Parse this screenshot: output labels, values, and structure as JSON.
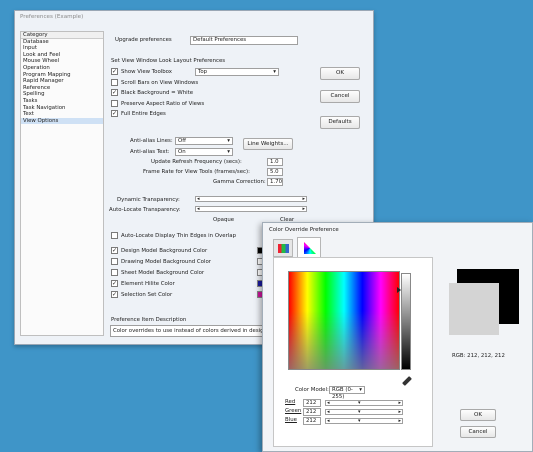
{
  "pref_window": {
    "title": "Preferences (Example)",
    "category_header": "Category",
    "categories": [
      "Database",
      "Input",
      "Look and Feel",
      "Mouse Wheel",
      "Operation",
      "Program Mapping",
      "Rapid Manager",
      "Reference",
      "Spelling",
      "Tasks",
      "Task Navigation",
      "Text",
      "View Options"
    ],
    "selected_category": "View Options",
    "prefs_for_label": "Upgrade preferences",
    "prefs_for_value": "Default Preferences",
    "section_title": "Set View Window Look Layout Preferences",
    "checks": [
      {
        "label": "Show View Toolbox",
        "checked": true
      },
      {
        "label": "Scroll Bars on View Windows",
        "checked": false
      },
      {
        "label": "Black Background = White",
        "checked": true
      },
      {
        "label": "Preserve Aspect Ratio of Views",
        "checked": false
      },
      {
        "label": "Full Entire Edges",
        "checked": true
      }
    ],
    "toolbox_combo": "Top",
    "ant_alias_label": "Anti-alias Lines:",
    "ant_alias_value": "Off",
    "ant_alias_text_label": "Anti-alias Text:",
    "ant_alias_text_value": "On",
    "line_weights_button": "Line Weights...",
    "refresh_label": "Update Refresh Frequency (secs):",
    "refresh_value": "1.0",
    "frame_rate_label": "Frame Rate for View Tools (frames/sec):",
    "frame_rate_value": "5.0",
    "gamma_label": "Gamma Correction:",
    "gamma_value": "1.70",
    "dynamic_label": "Dynamic Transparency:",
    "autolocate_label": "Auto-Locate Transparency:",
    "opaque_label": "Opaque",
    "clear_label": "Clear",
    "autolocate_check": "Auto-Locate Display Thin Edges in Overlap",
    "color_items": [
      {
        "label": "Design Model Background Color",
        "checked": true,
        "color": "#000000"
      },
      {
        "label": "Drawing Model Background Color",
        "checked": false,
        "color": "#ffffff"
      },
      {
        "label": "Sheet Model Background Color",
        "checked": false,
        "color": "#ffffff"
      },
      {
        "label": "Element Hilite Color",
        "checked": true,
        "color": "#1a1aa0"
      },
      {
        "label": "Selection Set Color",
        "checked": true,
        "color": "#d0149e"
      }
    ],
    "item_desc_label": "Preference Item Description",
    "item_desc_text": "Color overrides to use instead of colors derived in design",
    "ok": "OK",
    "cancel": "Cancel",
    "defaults": "Defaults"
  },
  "color_dialog": {
    "title": "Color Override Preference",
    "color_model_label": "Color Model:",
    "color_model_value": "RGB (0-255)",
    "rgb_label": "RGB: 212, 212, 212",
    "channels": [
      {
        "label": "Red",
        "value": "212"
      },
      {
        "label": "Green",
        "value": "212"
      },
      {
        "label": "Blue",
        "value": "212"
      }
    ],
    "ok": "OK",
    "cancel": "Cancel"
  }
}
